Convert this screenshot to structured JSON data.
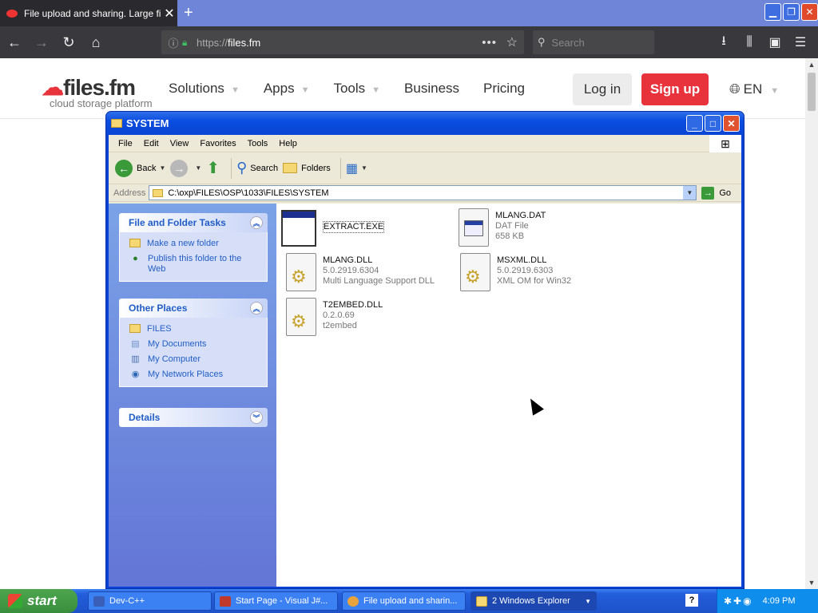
{
  "browser": {
    "tab_title": "File upload and sharing. Large file",
    "tab_close": "✕",
    "new_tab": "+",
    "url_proto": "https://",
    "url_host": "files.fm",
    "url_more": "•••",
    "search_placeholder": "Search"
  },
  "site": {
    "logo_brand": "files.fm",
    "logo_tagline": "cloud storage platform",
    "nav": [
      "Solutions",
      "Apps",
      "Tools",
      "Business",
      "Pricing"
    ],
    "login": "Log in",
    "signup": "Sign up",
    "lang": "EN"
  },
  "explorer": {
    "title": "SYSTEM",
    "menu": [
      "File",
      "Edit",
      "View",
      "Favorites",
      "Tools",
      "Help"
    ],
    "toolbar": {
      "back": "Back",
      "search": "Search",
      "folders": "Folders"
    },
    "address_label": "Address",
    "address_path": "C:\\oxp\\FILES\\OSP\\1033\\FILES\\SYSTEM",
    "go": "Go",
    "tasks_title": "File and Folder Tasks",
    "tasks": [
      "Make a new folder",
      "Publish this folder to the Web"
    ],
    "places_title": "Other Places",
    "places": [
      "FILES",
      "My Documents",
      "My Computer",
      "My Network Places"
    ],
    "details_title": "Details",
    "files": [
      {
        "name": "EXTRACT.EXE",
        "line2": "",
        "line3": ""
      },
      {
        "name": "MLANG.DAT",
        "line2": "DAT File",
        "line3": "658 KB"
      },
      {
        "name": "MLANG.DLL",
        "line2": "5.0.2919.6304",
        "line3": "Multi Language Support DLL"
      },
      {
        "name": "MSXML.DLL",
        "line2": "5.0.2919.6303",
        "line3": "XML OM for Win32"
      },
      {
        "name": "T2EMBED.DLL",
        "line2": "0.2.0.69",
        "line3": "t2embed"
      }
    ]
  },
  "taskbar": {
    "start": "start",
    "tasks": [
      "Dev-C++",
      "Start Page - Visual J#...",
      "File upload and sharin...",
      "2 Windows Explorer"
    ],
    "help": "?",
    "clock": "4:09 PM"
  },
  "colors": {
    "brand_red": "#e8323c",
    "xp_blue": "#0842d6",
    "firefox_dark": "#38383d"
  }
}
